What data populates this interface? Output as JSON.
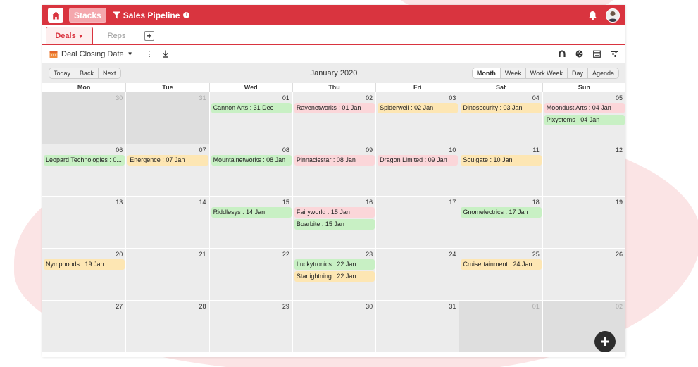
{
  "topbar": {
    "stacks_label": "Stacks",
    "pipeline_label": "Sales Pipeline",
    "info_glyph": "i",
    "icons": [
      "home-icon",
      "filter-icon",
      "info-icon",
      "bell-icon",
      "avatar"
    ]
  },
  "tabs": [
    {
      "label": "Deals",
      "active": true
    },
    {
      "label": "Reps",
      "active": false
    }
  ],
  "add_tab_glyph": "+",
  "toolbar": {
    "date_field_label": "Deal Closing Date",
    "kebab_glyph": "⋮",
    "right_icons": [
      "magnet-icon",
      "palette-icon",
      "calendar-icon",
      "sliders-icon"
    ]
  },
  "calendar": {
    "month_title": "January 2020",
    "nav_buttons": [
      "Today",
      "Back",
      "Next"
    ],
    "view_buttons": [
      "Month",
      "Week",
      "Work Week",
      "Day",
      "Agenda"
    ],
    "active_view": "Month",
    "day_names": [
      "Mon",
      "Tue",
      "Wed",
      "Thu",
      "Fri",
      "Sat",
      "Sun"
    ],
    "weeks": [
      [
        {
          "day": "30",
          "other": true,
          "events": []
        },
        {
          "day": "31",
          "other": true,
          "events": []
        },
        {
          "day": "01",
          "events": [
            {
              "label": "Cannon Arts : 31 Dec",
              "color": "green"
            }
          ]
        },
        {
          "day": "02",
          "events": [
            {
              "label": "Ravenetworks : 01 Jan",
              "color": "red"
            }
          ]
        },
        {
          "day": "03",
          "events": [
            {
              "label": "Spiderwell : 02 Jan",
              "color": "yellow"
            }
          ]
        },
        {
          "day": "04",
          "events": [
            {
              "label": "Dinosecurity : 03 Jan",
              "color": "yellow"
            }
          ]
        },
        {
          "day": "05",
          "events": [
            {
              "label": "Moondust Arts : 04 Jan",
              "color": "red"
            },
            {
              "label": "Pixystems : 04 Jan",
              "color": "green"
            }
          ]
        }
      ],
      [
        {
          "day": "06",
          "events": [
            {
              "label": "Leopard Technologies : 0...",
              "color": "green"
            }
          ]
        },
        {
          "day": "07",
          "events": [
            {
              "label": "Energence : 07 Jan",
              "color": "yellow"
            }
          ]
        },
        {
          "day": "08",
          "events": [
            {
              "label": "Mountainetworks : 08 Jan",
              "color": "green"
            }
          ]
        },
        {
          "day": "09",
          "events": [
            {
              "label": "Pinnaclestar : 08 Jan",
              "color": "red"
            }
          ]
        },
        {
          "day": "10",
          "events": [
            {
              "label": "Dragon Limited : 09 Jan",
              "color": "red"
            }
          ]
        },
        {
          "day": "11",
          "events": [
            {
              "label": "Soulgate : 10 Jan",
              "color": "yellow"
            }
          ]
        },
        {
          "day": "12",
          "events": []
        }
      ],
      [
        {
          "day": "13",
          "events": []
        },
        {
          "day": "14",
          "events": []
        },
        {
          "day": "15",
          "events": [
            {
              "label": "Riddlesys : 14 Jan",
              "color": "green"
            }
          ]
        },
        {
          "day": "16",
          "events": [
            {
              "label": "Fairyworld : 15 Jan",
              "color": "red"
            },
            {
              "label": "Boarbite : 15 Jan",
              "color": "green"
            }
          ]
        },
        {
          "day": "17",
          "events": []
        },
        {
          "day": "18",
          "events": [
            {
              "label": "Gnomelectrics : 17 Jan",
              "color": "green"
            }
          ]
        },
        {
          "day": "19",
          "events": []
        }
      ],
      [
        {
          "day": "20",
          "events": [
            {
              "label": "Nymphoods : 19 Jan",
              "color": "yellow"
            }
          ]
        },
        {
          "day": "21",
          "events": []
        },
        {
          "day": "22",
          "events": []
        },
        {
          "day": "23",
          "events": [
            {
              "label": "Luckytronics : 22 Jan",
              "color": "green"
            },
            {
              "label": "Starlightning : 22 Jan",
              "color": "yellow"
            }
          ]
        },
        {
          "day": "24",
          "events": []
        },
        {
          "day": "25",
          "events": [
            {
              "label": "Cruisertainment : 24 Jan",
              "color": "yellow"
            }
          ]
        },
        {
          "day": "26",
          "events": []
        }
      ],
      [
        {
          "day": "27",
          "events": []
        },
        {
          "day": "28",
          "events": []
        },
        {
          "day": "29",
          "events": []
        },
        {
          "day": "30",
          "events": []
        },
        {
          "day": "31",
          "events": []
        },
        {
          "day": "01",
          "other": true,
          "events": []
        },
        {
          "day": "02",
          "other": true,
          "events": []
        }
      ]
    ]
  },
  "colors": {
    "brand": "#d9343f",
    "event_green": "#c8f0c4",
    "event_red": "#fbd6d9",
    "event_yellow": "#fde6b3"
  }
}
